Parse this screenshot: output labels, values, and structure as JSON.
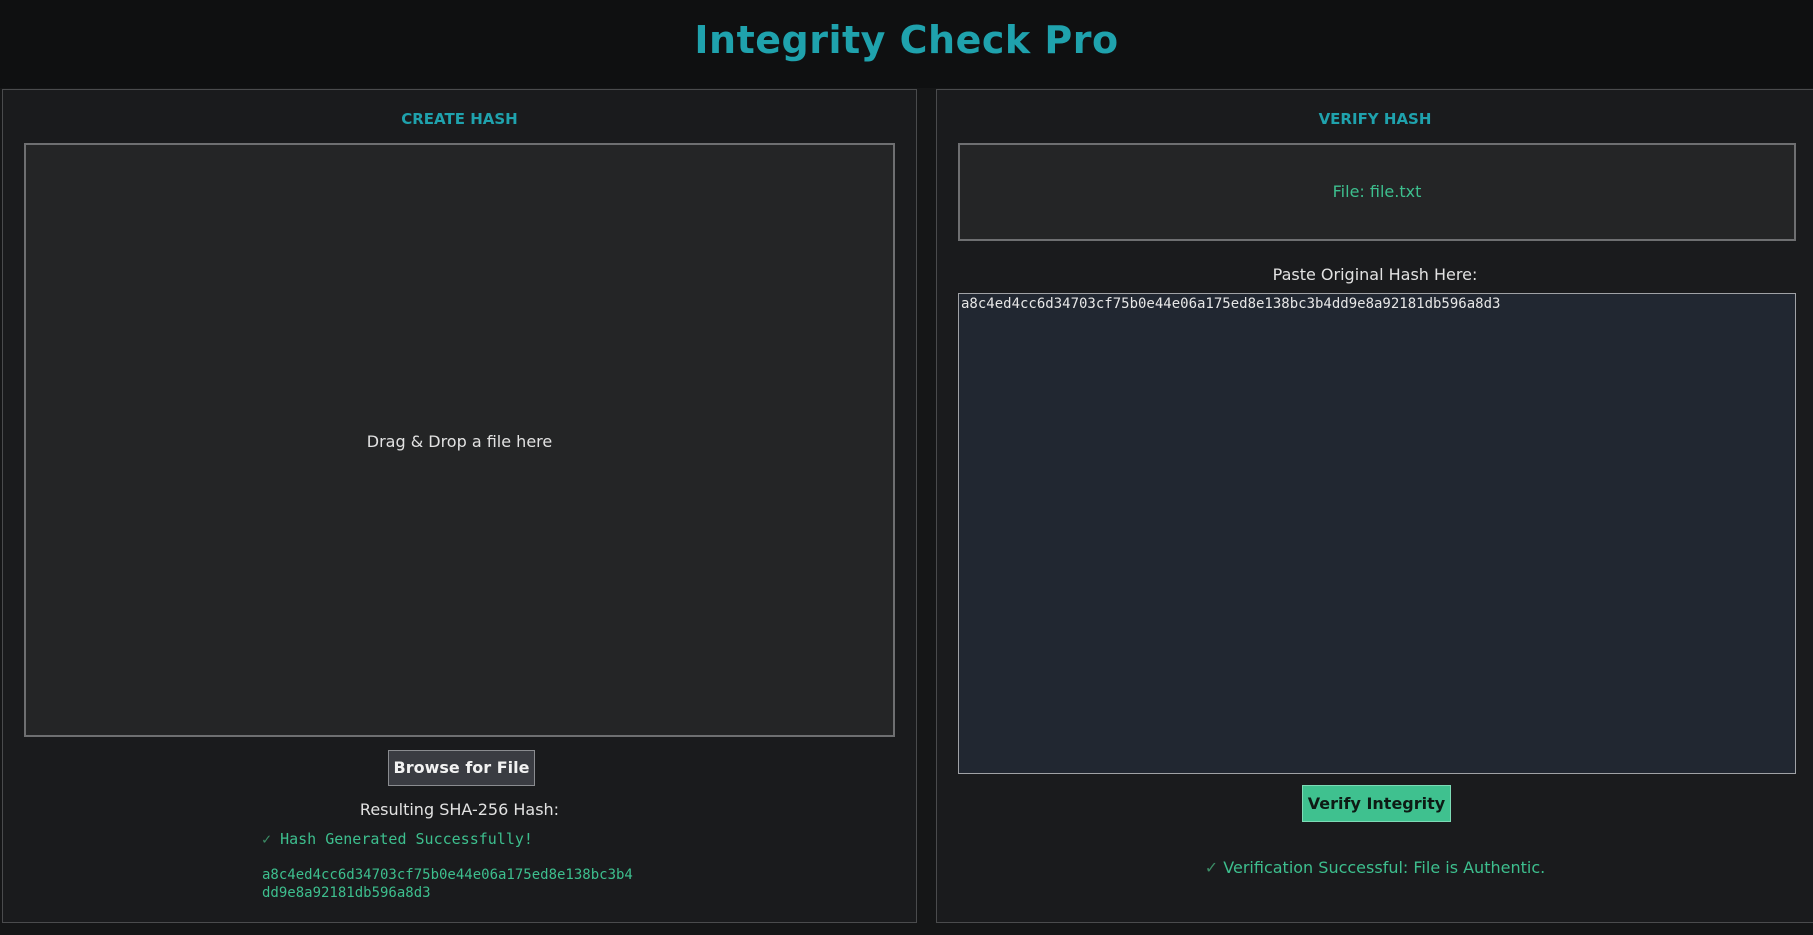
{
  "app": {
    "title": "Integrity Check Pro"
  },
  "create": {
    "heading": "CREATE HASH",
    "dropzone_text": "Drag & Drop a file here",
    "browse_label": "Browse for File",
    "result_label": "Resulting SHA-256 Hash:",
    "status_icon": "✓",
    "status_text": "Hash Generated Successfully!",
    "hash_line1": "a8c4ed4cc6d34703cf75b0e44e06a175ed8e138bc3b4",
    "hash_line2": "dd9e8a92181db596a8d3"
  },
  "verify": {
    "heading": "VERIFY HASH",
    "file_label": "File: file.txt",
    "paste_label": "Paste Original Hash Here:",
    "hash_value": "a8c4ed4cc6d34703cf75b0e44e06a175ed8e138bc3b4dd9e8a92181db596a8d3",
    "verify_label": "Verify Integrity",
    "result_icon": "✓",
    "result_text": "Verification Successful: File is Authentic."
  },
  "colors": {
    "accent": "#1fa2ad",
    "success": "#3dbf8e",
    "background": "#151617"
  }
}
